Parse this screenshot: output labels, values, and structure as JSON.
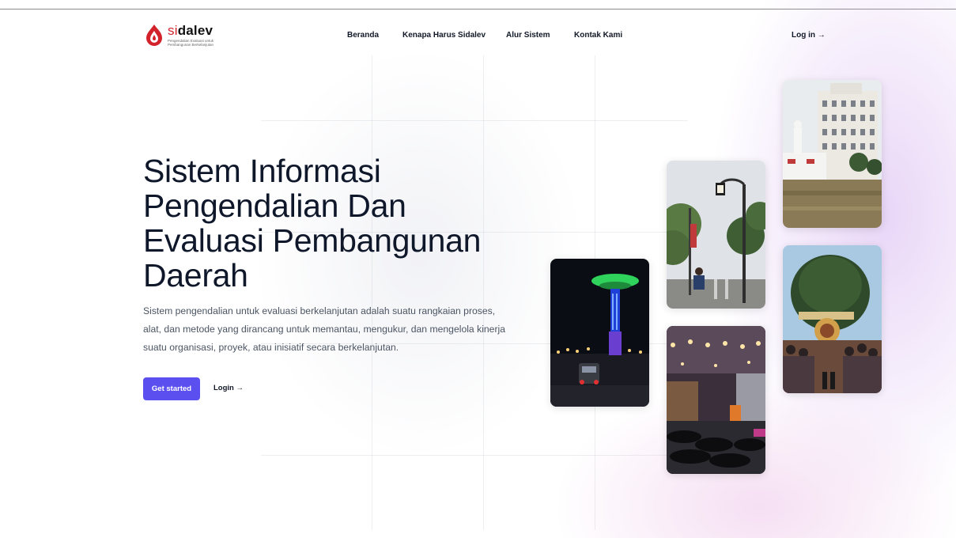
{
  "brand": {
    "name_prefix": "si",
    "name_suffix": "dalev",
    "tagline": "Pengendalian Evaluasi untuk Pembangunan Berkelanjutan",
    "color": "#d2232a"
  },
  "nav": {
    "items": [
      {
        "label": "Beranda"
      },
      {
        "label": "Kenapa Harus Sidalev"
      },
      {
        "label": "Alur Sistem"
      },
      {
        "label": "Kontak Kami"
      }
    ],
    "login_label": "Log in →"
  },
  "hero": {
    "title": "Sistem Informasi Pengendalian Dan Evaluasi Pembangunan Daerah",
    "description": "Sistem pengendalian untuk evaluasi berkelanjutan adalah suatu rangkaian proses, alat, dan metode yang dirancang untuk memantau, mengukur, dan mengelola kinerja suatu organisasi, proyek, atau inisiatif secara berkelanjutan.",
    "primary_button": "Get started",
    "secondary_button": "Login →",
    "accent_color": "#5b4ff0"
  },
  "photos": [
    {
      "name": "photo-night-tower"
    },
    {
      "name": "photo-street-lamp"
    },
    {
      "name": "photo-night-market"
    },
    {
      "name": "photo-flooded-building"
    },
    {
      "name": "photo-reog-performance"
    }
  ]
}
